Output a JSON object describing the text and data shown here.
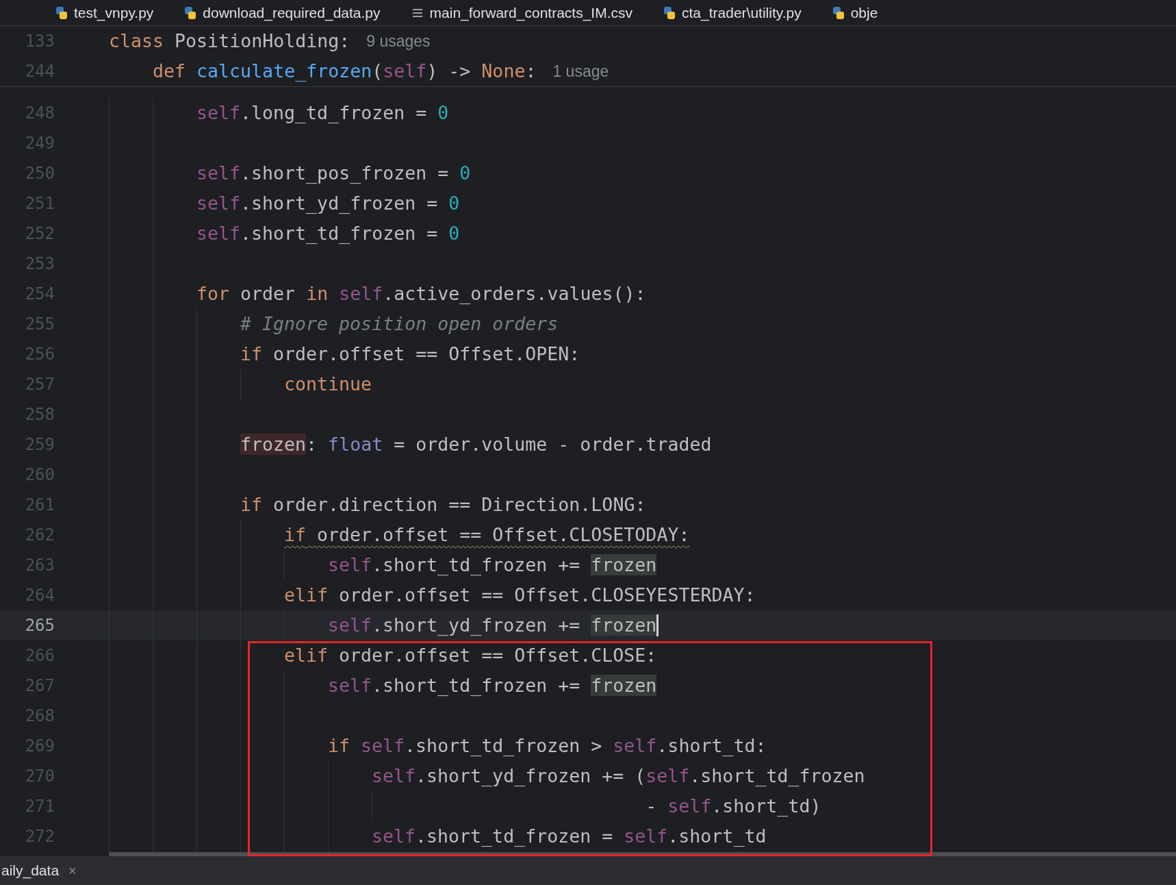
{
  "tabs": [
    {
      "label": "test_vnpy.py",
      "kind": "python"
    },
    {
      "label": "download_required_data.py",
      "kind": "python"
    },
    {
      "label": "main_forward_contracts_IM.csv",
      "kind": "csv"
    },
    {
      "label": "cta_trader\\utility.py",
      "kind": "python"
    },
    {
      "label": "obje",
      "kind": "python"
    }
  ],
  "sticky_header": [
    {
      "number": "133",
      "tokens": [
        {
          "kind": "kw",
          "text": "class"
        },
        {
          "kind": "plain",
          "text": " PositionHolding:"
        }
      ],
      "hint": "9 usages",
      "children": [
        {
          "number": "244",
          "tokens": [
            {
              "kind": "kw",
              "text": "def"
            },
            {
              "kind": "fn",
              "text": " calculate_frozen"
            },
            {
              "kind": "plain",
              "text": "("
            },
            {
              "kind": "self",
              "text": "self"
            },
            {
              "kind": "plain",
              "text": ") -> "
            },
            {
              "kind": "kw",
              "text": "None"
            },
            {
              "kind": "plain",
              "text": ":"
            }
          ],
          "hint": "1 usage"
        }
      ]
    }
  ],
  "lines": [
    {
      "number": "248",
      "tokens": [
        {
          "kind": "self",
          "text": "self"
        },
        {
          "kind": "plain",
          "text": ".long_td_frozen = "
        },
        {
          "kind": "num",
          "text": "0"
        }
      ]
    },
    {
      "number": "249"
    },
    {
      "number": "250",
      "tokens": [
        {
          "kind": "self",
          "text": "self"
        },
        {
          "kind": "plain",
          "text": ".short_pos_frozen = "
        },
        {
          "kind": "num",
          "text": "0"
        }
      ]
    },
    {
      "number": "251",
      "tokens": [
        {
          "kind": "self",
          "text": "self"
        },
        {
          "kind": "plain",
          "text": ".short_yd_frozen = "
        },
        {
          "kind": "num",
          "text": "0"
        }
      ]
    },
    {
      "number": "252",
      "tokens": [
        {
          "kind": "self",
          "text": "self"
        },
        {
          "kind": "plain",
          "text": ".short_td_frozen = "
        },
        {
          "kind": "num",
          "text": "0"
        }
      ]
    },
    {
      "number": "253"
    },
    {
      "number": "254",
      "tokens": [
        {
          "kind": "kw",
          "text": "for"
        },
        {
          "kind": "plain",
          "text": " order "
        },
        {
          "kind": "kw",
          "text": "in"
        },
        {
          "kind": "self",
          "text": " self"
        },
        {
          "kind": "plain",
          "text": ".active_orders.values():"
        }
      ],
      "children": [
        {
          "number": "255",
          "tokens": [
            {
              "kind": "comment",
              "text": "# Ignore position open orders"
            }
          ]
        },
        {
          "number": "256",
          "tokens": [
            {
              "kind": "kw",
              "text": "if"
            },
            {
              "kind": "plain",
              "text": " order.offset == Offset.OPEN:"
            }
          ],
          "children": [
            {
              "number": "257",
              "tokens": [
                {
                  "kind": "kw",
                  "text": "continue"
                }
              ]
            }
          ]
        },
        {
          "number": "258"
        },
        {
          "number": "259",
          "tokens": [
            {
              "kind": "plain",
              "text": "frozen",
              "highlighted": true,
              "write_access": true
            },
            {
              "kind": "plain",
              "text": ": "
            },
            {
              "kind": "type",
              "text": "float"
            },
            {
              "kind": "plain",
              "text": " = order.volume - order.traded"
            }
          ]
        },
        {
          "number": "260"
        },
        {
          "number": "261",
          "tokens": [
            {
              "kind": "kw",
              "text": "if"
            },
            {
              "kind": "plain",
              "text": " order.direction == Direction.LONG:"
            }
          ],
          "children": [
            {
              "number": "262",
              "tokens": [
                {
                  "kind": "kw",
                  "text": "if",
                  "warning": true
                },
                {
                  "kind": "plain",
                  "text": " order.offset == Offset.CLOSETODAY:",
                  "warning": true
                }
              ],
              "children": [
                {
                  "number": "263",
                  "tokens": [
                    {
                      "kind": "self",
                      "text": "self"
                    },
                    {
                      "kind": "plain",
                      "text": ".short_td_frozen += "
                    },
                    {
                      "kind": "plain",
                      "text": "frozen",
                      "highlighted": true,
                      "write_access": false
                    }
                  ]
                }
              ]
            },
            {
              "number": "264",
              "tokens": [
                {
                  "kind": "kw",
                  "text": "elif"
                },
                {
                  "kind": "plain",
                  "text": " order.offset == Offset.CLOSEYESTERDAY:"
                }
              ],
              "children": [
                {
                  "number": "265",
                  "current": true,
                  "caret": true,
                  "tokens": [
                    {
                      "kind": "self",
                      "text": "self"
                    },
                    {
                      "kind": "plain",
                      "text": ".short_yd_frozen += "
                    },
                    {
                      "kind": "plain",
                      "text": "frozen",
                      "highlighted": true,
                      "write_access": false
                    }
                  ]
                }
              ]
            },
            {
              "number": "266",
              "tokens": [
                {
                  "kind": "kw",
                  "text": "elif"
                },
                {
                  "kind": "plain",
                  "text": " order.offset == Offset.CLOSE:"
                }
              ],
              "children": [
                {
                  "number": "267",
                  "tokens": [
                    {
                      "kind": "self",
                      "text": "self"
                    },
                    {
                      "kind": "plain",
                      "text": ".short_td_frozen += "
                    },
                    {
                      "kind": "plain",
                      "text": "frozen",
                      "highlighted": true,
                      "write_access": false
                    }
                  ]
                },
                {
                  "number": "268"
                },
                {
                  "number": "269",
                  "tokens": [
                    {
                      "kind": "kw",
                      "text": "if"
                    },
                    {
                      "kind": "self",
                      "text": " self"
                    },
                    {
                      "kind": "plain",
                      "text": ".short_td_frozen > "
                    },
                    {
                      "kind": "self",
                      "text": "self"
                    },
                    {
                      "kind": "plain",
                      "text": ".short_td:"
                    }
                  ],
                  "children": [
                    {
                      "number": "270",
                      "tokens": [
                        {
                          "kind": "self",
                          "text": "self"
                        },
                        {
                          "kind": "plain",
                          "text": ".short_yd_frozen += ("
                        },
                        {
                          "kind": "self",
                          "text": "self"
                        },
                        {
                          "kind": "plain",
                          "text": ".short_td_frozen"
                        }
                      ],
                      "children": [
                        {
                          "number": "271",
                          "tokens": [
                            {
                              "kind": "plain",
                              "text": "                     - "
                            },
                            {
                              "kind": "self",
                              "text": "self"
                            },
                            {
                              "kind": "plain",
                              "text": ".short_td)"
                            }
                          ]
                        }
                      ]
                    },
                    {
                      "number": "272",
                      "tokens": [
                        {
                          "kind": "self",
                          "text": "self"
                        },
                        {
                          "kind": "plain",
                          "text": ".short_td_frozen = "
                        },
                        {
                          "kind": "self",
                          "text": "self"
                        },
                        {
                          "kind": "plain",
                          "text": ".short_td"
                        }
                      ]
                    }
                  ]
                }
              ]
            }
          ]
        }
      ]
    }
  ],
  "bottom_panel": {
    "tabs": [
      {
        "label": "aily_data",
        "close": "×"
      }
    ]
  }
}
